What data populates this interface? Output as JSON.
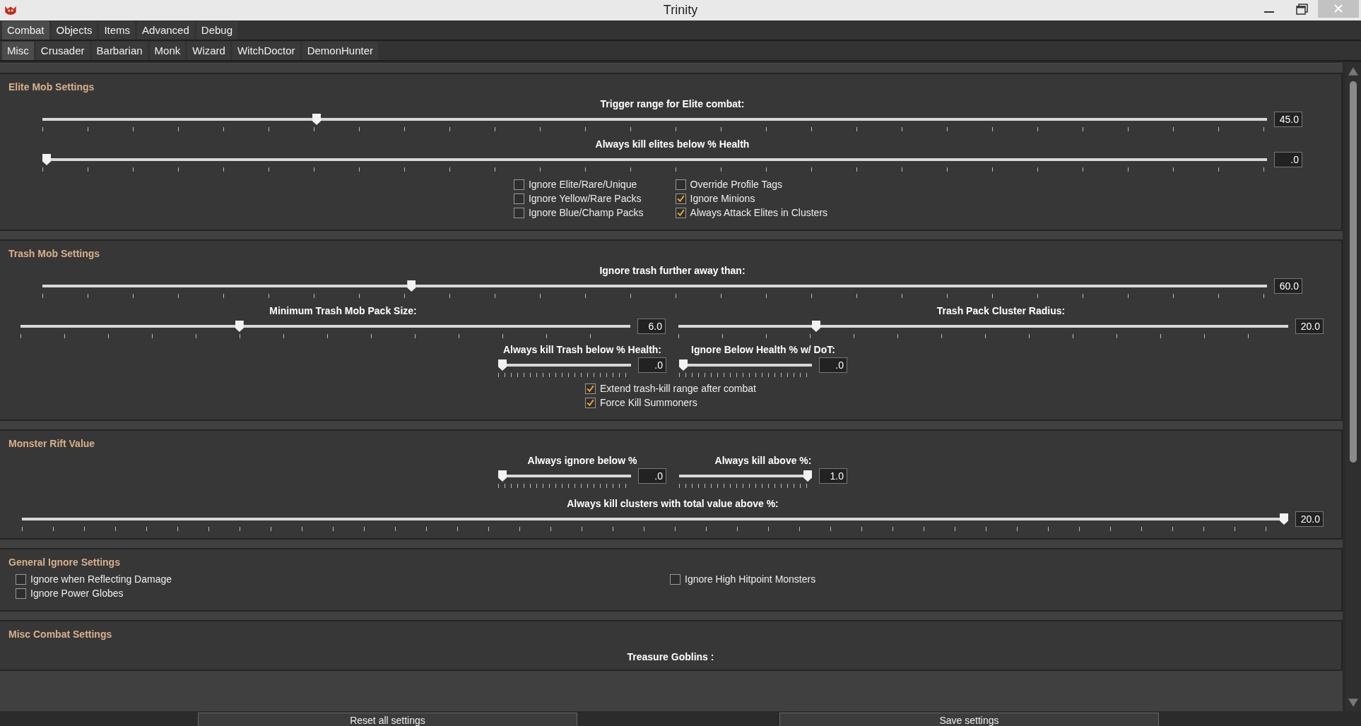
{
  "window": {
    "title": "Trinity"
  },
  "tabs": [
    {
      "label": "Combat",
      "selected": true
    },
    {
      "label": "Objects",
      "selected": false
    },
    {
      "label": "Items",
      "selected": false
    },
    {
      "label": "Advanced",
      "selected": false
    },
    {
      "label": "Debug",
      "selected": false
    }
  ],
  "subtabs": [
    {
      "label": "Misc",
      "selected": true
    },
    {
      "label": "Crusader",
      "selected": false
    },
    {
      "label": "Barbarian",
      "selected": false
    },
    {
      "label": "Monk",
      "selected": false
    },
    {
      "label": "Wizard",
      "selected": false
    },
    {
      "label": "WitchDoctor",
      "selected": false
    },
    {
      "label": "DemonHunter",
      "selected": false
    }
  ],
  "sections": [
    {
      "title": "Elite Mob Settings",
      "items": [
        {
          "kind": "slider",
          "label": "Trigger range for Elite combat:",
          "level": 0.222,
          "value": "45.0"
        },
        {
          "kind": "slider",
          "label": "Always kill elites below % Health",
          "level": 0,
          "value": ".0"
        },
        {
          "kind": "checks",
          "columns": [
            [
              {
                "label": "Ignore Elite/Rare/Unique",
                "checked": false
              },
              {
                "label": "Ignore Yellow/Rare Packs",
                "checked": false
              },
              {
                "label": "Ignore Blue/Champ Packs",
                "checked": false
              }
            ],
            [
              {
                "label": "Override Profile Tags",
                "checked": false
              },
              {
                "label": "Ignore Minions",
                "checked": true
              },
              {
                "label": "Always Attack Elites in Clusters",
                "checked": true
              }
            ]
          ]
        }
      ]
    },
    {
      "title": "Trash Mob Settings",
      "items": [
        {
          "kind": "slider",
          "label": "Ignore trash further away than:",
          "level": 0.3,
          "value": "60.0"
        },
        {
          "kind": "pair_half",
          "sliders": [
            {
              "label": "Minimum Trash Mob Pack Size:",
              "level": 0.357,
              "value": "6.0"
            },
            {
              "label": "Trash Pack Cluster Radius:",
              "level": 0.222,
              "value": "20.0"
            }
          ]
        },
        {
          "kind": "pair_small",
          "sliders": [
            {
              "label": "Always kill Trash below % Health:",
              "level": 0,
              "value": ".0"
            },
            {
              "label": "Ignore Below Health % w/ DoT:",
              "level": 0,
              "value": ".0"
            }
          ]
        },
        {
          "kind": "checks",
          "columns": [
            [
              {
                "label": "Extend trash-kill range after combat",
                "checked": true
              },
              {
                "label": "Force Kill Summoners",
                "checked": true
              }
            ]
          ]
        }
      ]
    },
    {
      "title": "Monster Rift Value",
      "items": [
        {
          "kind": "pair_small",
          "sliders": [
            {
              "label": "Always ignore below %",
              "level": 0,
              "value": ".0"
            },
            {
              "label": "Always kill above %:",
              "level": 1,
              "value": "1.0"
            }
          ]
        },
        {
          "kind": "slider_wide",
          "label": "Always kill clusters with total value above %:",
          "level": 1,
          "value": "20.0"
        }
      ]
    },
    {
      "title": "General Ignore Settings",
      "items": [
        {
          "kind": "checks_wide",
          "columns": [
            [
              {
                "label": "Ignore when Reflecting Damage",
                "checked": false
              },
              {
                "label": "Ignore Power Globes",
                "checked": false
              }
            ],
            [
              {
                "label": "Ignore High Hitpoint Monsters",
                "checked": false
              }
            ]
          ]
        }
      ]
    },
    {
      "title": "Misc Combat Settings",
      "items": [
        {
          "kind": "heading",
          "text": "Treasure Goblins :"
        }
      ]
    }
  ],
  "buttons": [
    "Reset all settings",
    "Save settings"
  ]
}
